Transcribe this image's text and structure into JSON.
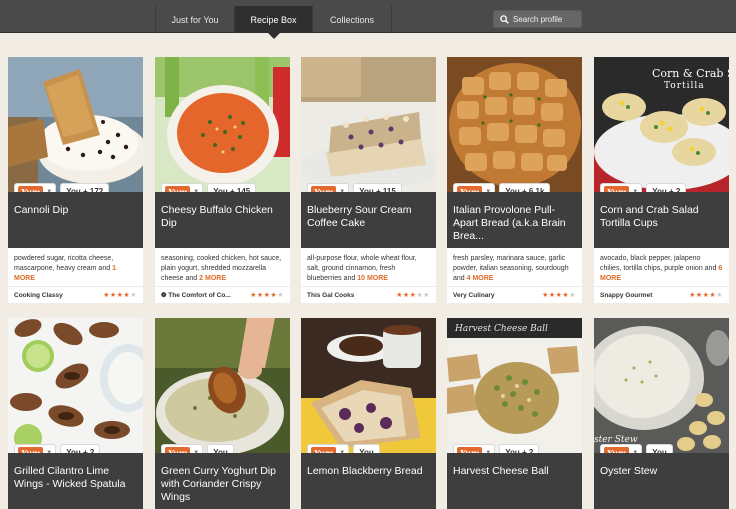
{
  "nav": {
    "tabs": [
      {
        "label": "Just for You"
      },
      {
        "label": "Recipe Box"
      },
      {
        "label": "Collections"
      }
    ],
    "search_placeholder": "Search profile"
  },
  "yum_label": "Yum",
  "row1": [
    {
      "title": "Cannoli Dip",
      "count": "You + 172",
      "ingredients": "powdered sugar, ricotta cheese, mascarpone, heavy cream and",
      "more": "1 MORE",
      "source": "Cooking Classy",
      "rating": 4
    },
    {
      "title": "Cheesy Buffalo Chicken Dip",
      "count": "You + 145",
      "ingredients": "seasoning, cooked chicken, hot sauce, plain yogurt, shredded mozzarella cheese and",
      "more": "2 MORE",
      "source": "The Comfort of Co...",
      "rating": 4
    },
    {
      "title": "Blueberry Sour Cream Coffee Cake",
      "count": "You + 115",
      "ingredients": "all-purpose flour, whole wheat flour, salt, ground cinnamon, fresh blueberries and",
      "more": "10 MORE",
      "source": "This Gal Cooks",
      "rating": 3
    },
    {
      "title": "Italian Provolone Pull-Apart Bread (a.k.a Brain Brea...",
      "count": "You + 6.1k",
      "ingredients": "fresh parsley, marinara sauce, garlic powder, italian seasoning, sourdough and",
      "more": "4 MORE",
      "source": "Very Culinary",
      "rating": 4
    },
    {
      "title": "Corn and Crab Salad Tortilla Cups",
      "count": "You + 2",
      "ingredients": "avocado, black pepper, jalapeno chilies, tortilla chips, purple onion and",
      "more": "6 MORE",
      "source": "Snappy Gourmet",
      "rating": 4
    }
  ],
  "row2": [
    {
      "title": "Grilled Cilantro Lime Wings - Wicked Spatula",
      "count": "You + 2"
    },
    {
      "title": "Green Curry Yoghurt Dip with Coriander Crispy Wings",
      "count": "You"
    },
    {
      "title": "Lemon Blackberry Bread",
      "count": "You"
    },
    {
      "title": "Harvest Cheese Ball",
      "count": "You + 2"
    },
    {
      "title": "Oyster Stew",
      "count": "You"
    }
  ],
  "photo_overlays": {
    "corn_crab": "Corn & Crab S Tortilla",
    "harvest": "Harvest Cheese Ball",
    "oyster": "ster Stew"
  },
  "colors": {
    "accent": "#e36a2e",
    "nav_bg": "#4a4a4a",
    "title_bg": "#3e3e3e",
    "page_bg": "#f1ede4"
  }
}
